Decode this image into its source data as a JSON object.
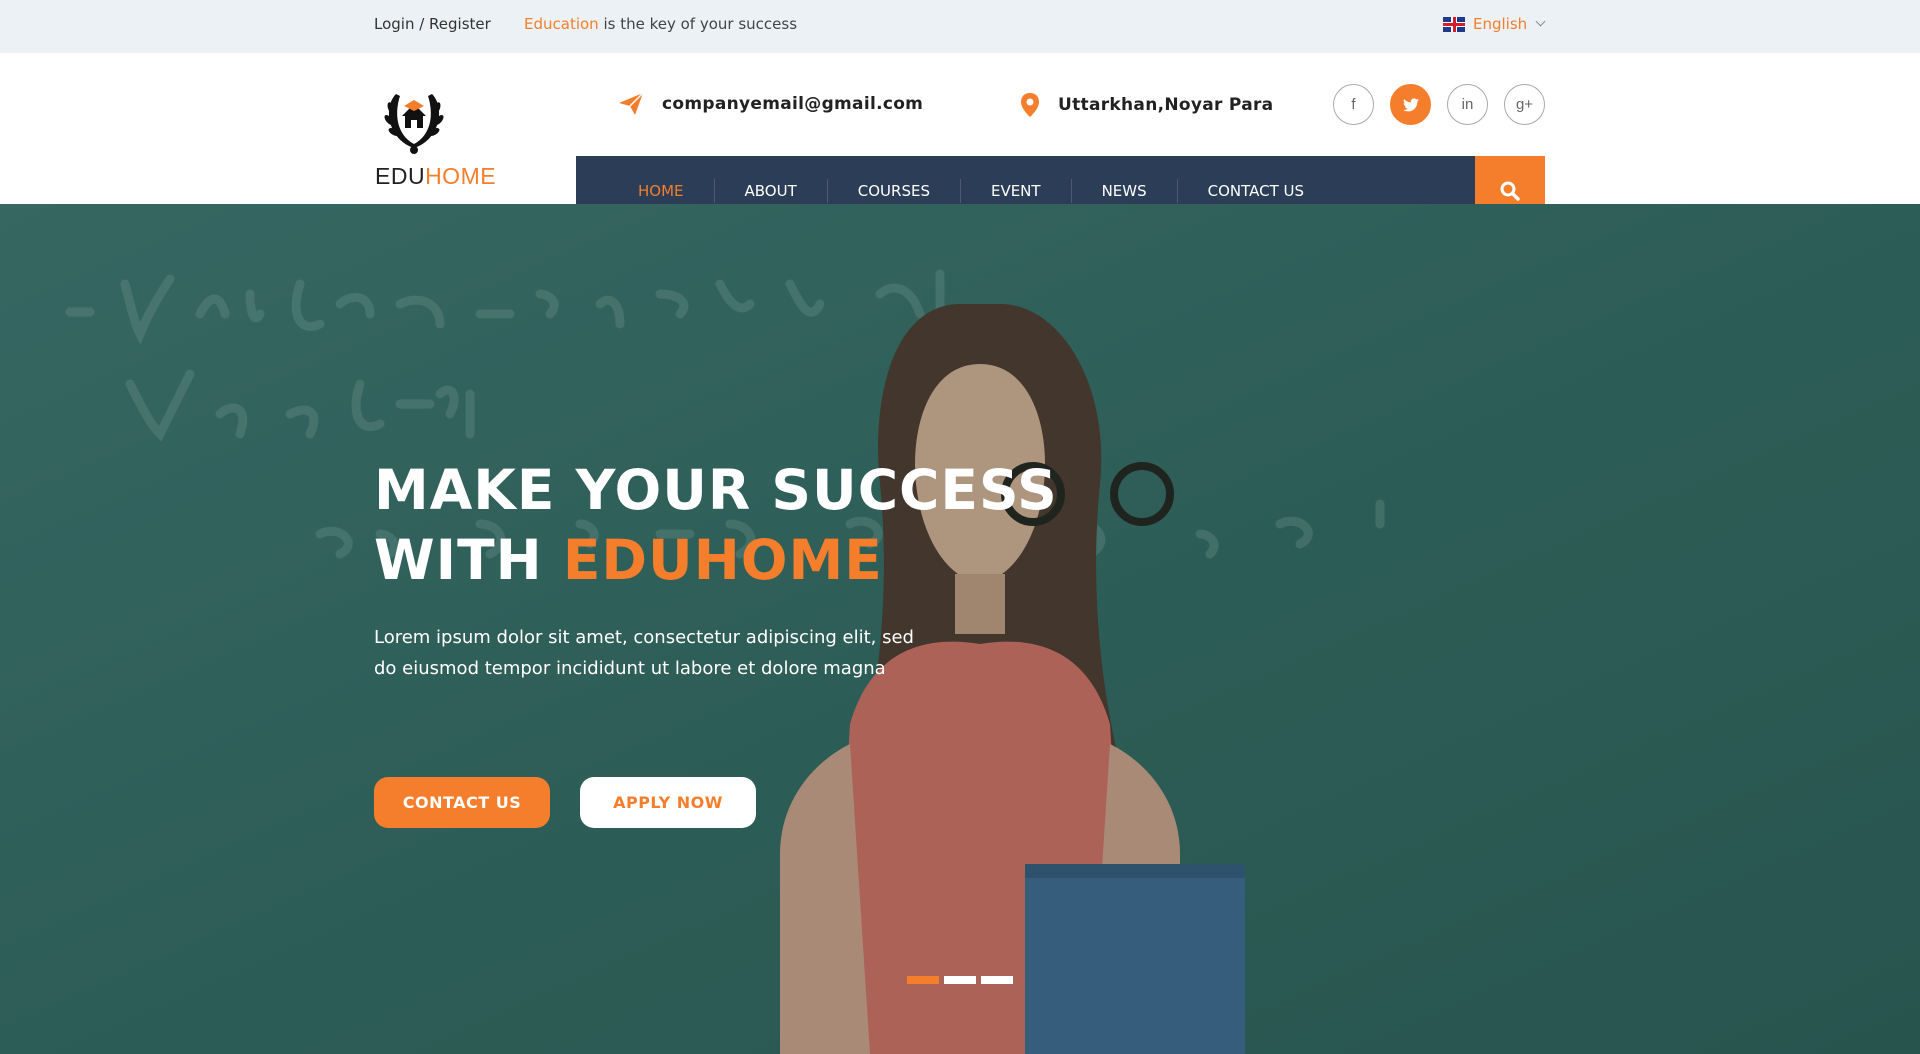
{
  "topbar": {
    "login_register": "Login / Register",
    "tagline_highlight": "Education",
    "tagline_rest": " is the key of your success",
    "language": "English"
  },
  "header": {
    "logo_part1": "EDU",
    "logo_part2": "HOME",
    "email": "companyemail@gmail.com",
    "address": "Uttarkhan,Noyar Para",
    "socials": [
      "f",
      "t",
      "in",
      "g+"
    ]
  },
  "nav": {
    "items": [
      "HOME",
      "ABOUT",
      "COURSES",
      "EVENT",
      "NEWS",
      "CONTACT US"
    ],
    "active": "HOME"
  },
  "hero": {
    "title_line1": "MAKE YOUR SUCCESS",
    "title_line2_prefix": "WITH ",
    "title_line2_highlight": "EDUHOME",
    "description": "Lorem ipsum dolor sit amet, consectetur adipiscing elit, sed do eiusmod tempor incididunt ut labore et dolore magna",
    "btn_contact": "CONTACT US",
    "btn_apply": "APPLY NOW",
    "slide_count": 3,
    "active_slide": 1
  },
  "colors": {
    "accent": "#f47e2b",
    "nav_bg": "#2c3e57",
    "topbar_bg": "#ecf1f5",
    "hero_overlay": "#2f5f5a"
  }
}
